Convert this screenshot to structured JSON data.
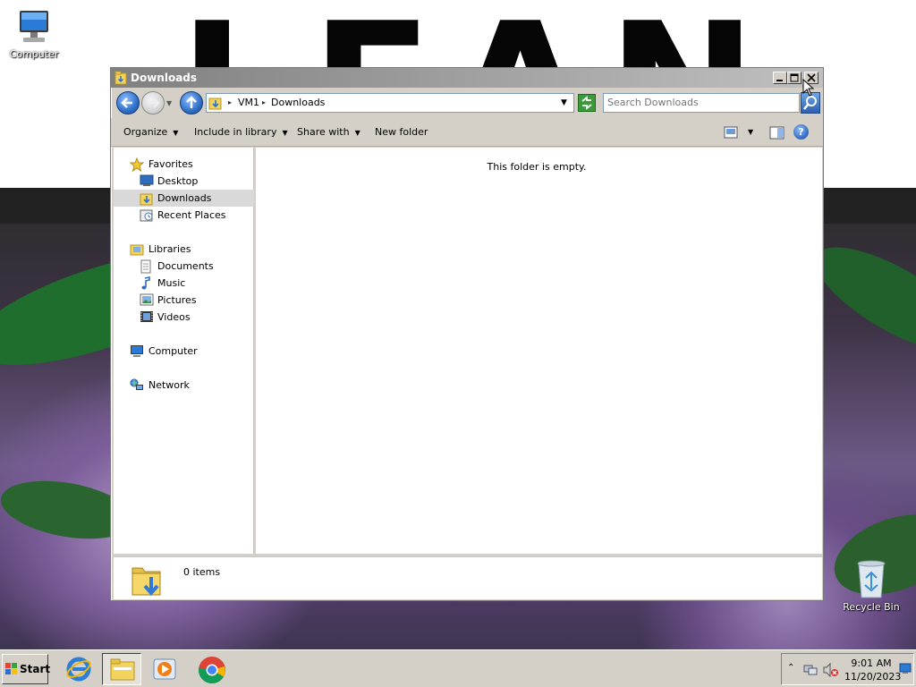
{
  "desktop": {
    "wallpaper_text": "LEAN",
    "icons": [
      {
        "label": "Computer",
        "icon": "computer-icon"
      },
      {
        "label": "Recycle Bin",
        "icon": "recycle-bin-icon"
      }
    ]
  },
  "window": {
    "title": "Downloads",
    "address": {
      "crumbs": [
        "VM1",
        "Downloads"
      ]
    },
    "search": {
      "placeholder": "Search Downloads"
    },
    "toolbar": {
      "organize": "Organize",
      "include_in_library": "Include in library",
      "share_with": "Share with",
      "new_folder": "New folder",
      "help": "?"
    },
    "nav": {
      "favorites": {
        "label": "Favorites",
        "items": [
          {
            "label": "Desktop"
          },
          {
            "label": "Downloads",
            "selected": true
          },
          {
            "label": "Recent Places"
          }
        ]
      },
      "libraries": {
        "label": "Libraries",
        "items": [
          {
            "label": "Documents"
          },
          {
            "label": "Music"
          },
          {
            "label": "Pictures"
          },
          {
            "label": "Videos"
          }
        ]
      },
      "computer": "Computer",
      "network": "Network"
    },
    "content": {
      "empty_message": "This folder is empty."
    },
    "details": {
      "item_count": "0 items"
    }
  },
  "taskbar": {
    "start_label": "Start",
    "apps": [
      {
        "icon": "internet-explorer-icon"
      },
      {
        "icon": "file-explorer-icon",
        "active": true
      },
      {
        "icon": "media-player-icon"
      },
      {
        "icon": "chrome-icon"
      }
    ],
    "clock": {
      "time": "9:01 AM",
      "date": "11/20/2023"
    }
  }
}
